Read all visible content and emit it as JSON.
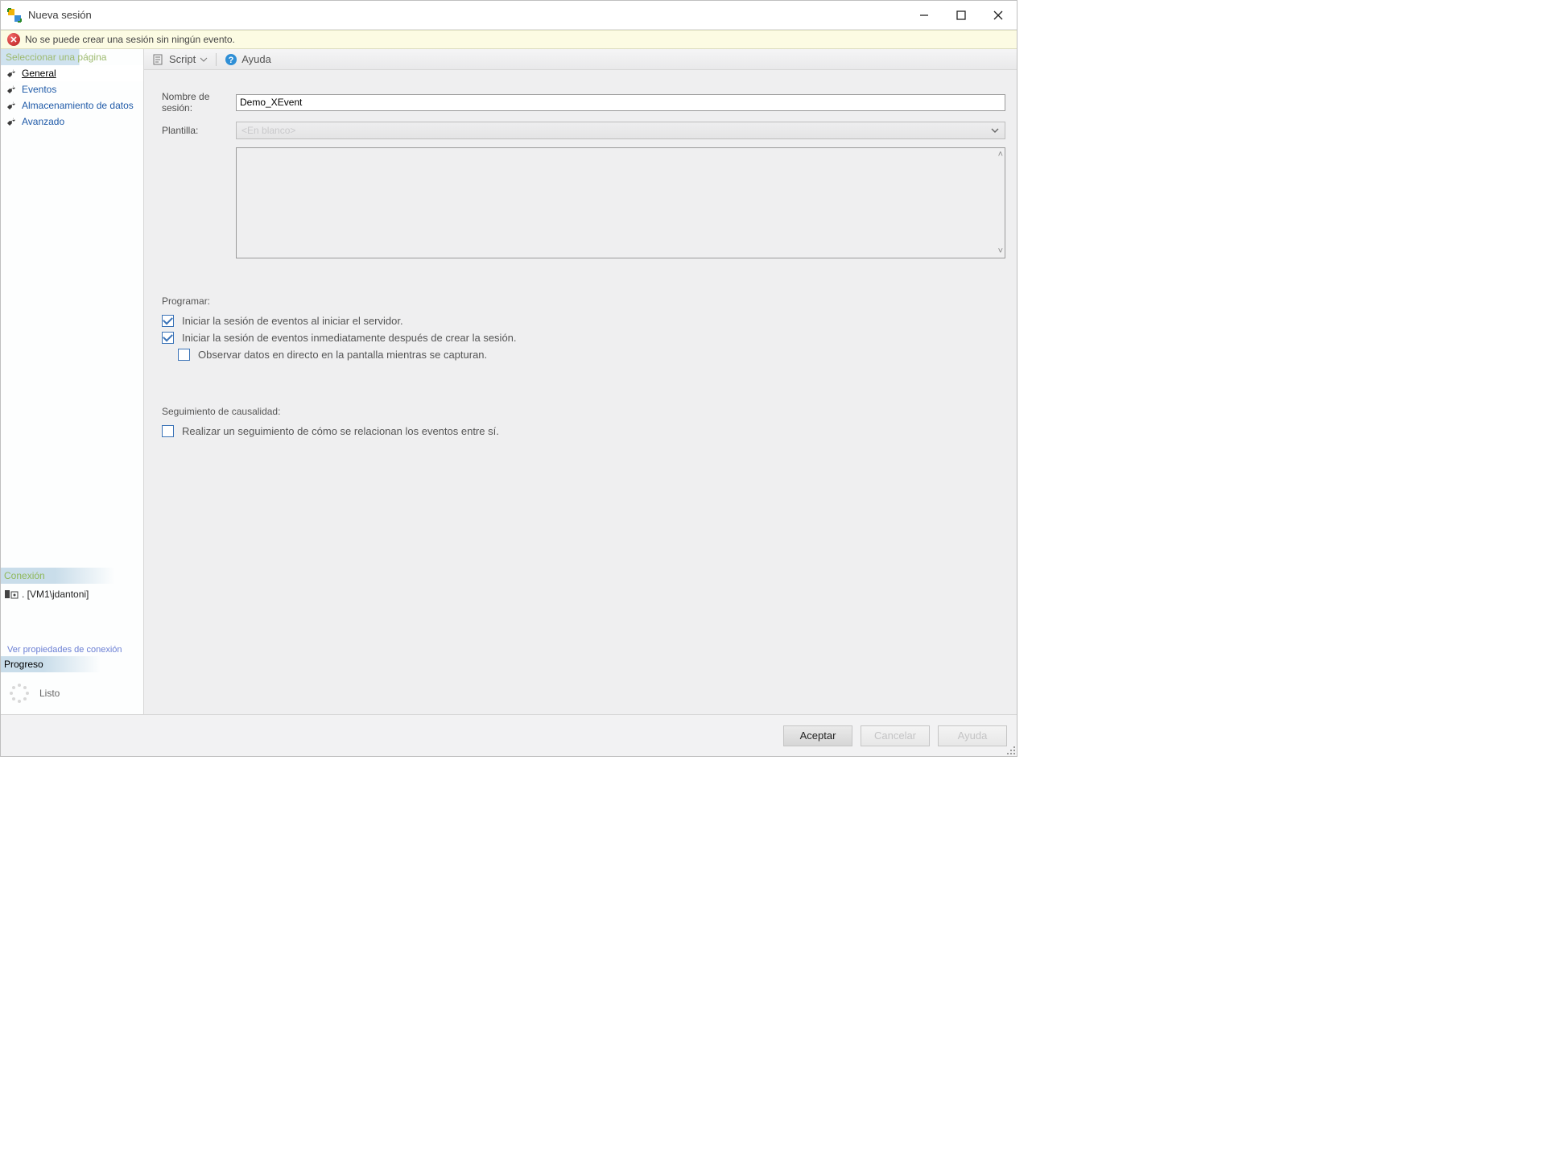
{
  "title": "Nueva sesión",
  "error": "No se puede crear una sesión sin ningún evento.",
  "sidebar": {
    "header": "Seleccionar una página",
    "items": [
      {
        "label": "General",
        "active": true
      },
      {
        "label": "Eventos"
      },
      {
        "label": "Almacenamiento de datos"
      },
      {
        "label": "Avanzado"
      }
    ],
    "connection_header": "Conexión",
    "connection_value": ". [VM1\\jdantoni]",
    "view_conn_link": "Ver propiedades de conexión",
    "progress_header": "Progreso",
    "progress_value": "Listo"
  },
  "toolbar": {
    "script": "Script",
    "help": "Ayuda"
  },
  "form": {
    "name_label": "Nombre de sesión:",
    "name_value": "Demo_XEvent",
    "template_label": "Plantilla:",
    "template_placeholder": "<En blanco>",
    "schedule_header": "Programar:",
    "chk_start_server": "Iniciar la sesión de eventos al iniciar el servidor.",
    "chk_start_immediate": "Iniciar la sesión de eventos inmediatamente después de crear la sesión.",
    "chk_watch_live": "Observar datos en directo en la pantalla mientras se capturan.",
    "causality_header": "Seguimiento de causalidad:",
    "chk_causality": "Realizar un seguimiento de cómo se relacionan los eventos entre sí."
  },
  "buttons": {
    "ok": "Aceptar",
    "cancel": "Cancelar",
    "help": "Ayuda"
  }
}
